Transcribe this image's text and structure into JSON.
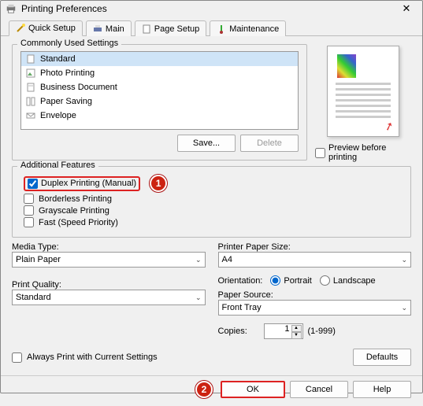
{
  "window": {
    "title": "Printing Preferences"
  },
  "tabs": [
    {
      "label": "Quick Setup"
    },
    {
      "label": "Main"
    },
    {
      "label": "Page Setup"
    },
    {
      "label": "Maintenance"
    }
  ],
  "commonly_used": {
    "legend": "Commonly Used Settings",
    "items": [
      "Standard",
      "Photo Printing",
      "Business Document",
      "Paper Saving",
      "Envelope"
    ]
  },
  "btns": {
    "save": "Save...",
    "delete": "Delete"
  },
  "preview_label": "Preview before printing",
  "additional": {
    "legend": "Additional Features",
    "duplex": "Duplex Printing (Manual)",
    "borderless": "Borderless Printing",
    "grayscale": "Grayscale Printing",
    "fast": "Fast (Speed Priority)"
  },
  "media_type": {
    "label": "Media Type:",
    "value": "Plain Paper"
  },
  "print_quality": {
    "label": "Print Quality:",
    "value": "Standard"
  },
  "paper_size": {
    "label": "Printer Paper Size:",
    "value": "A4"
  },
  "orientation": {
    "label": "Orientation:",
    "portrait": "Portrait",
    "landscape": "Landscape"
  },
  "paper_source": {
    "label": "Paper Source:",
    "value": "Front Tray"
  },
  "copies": {
    "label": "Copies:",
    "value": "1",
    "range": "(1-999)"
  },
  "always_print": "Always Print with Current Settings",
  "defaults": "Defaults",
  "ok": "OK",
  "cancel": "Cancel",
  "help": "Help",
  "callouts": {
    "one": "1",
    "two": "2"
  }
}
